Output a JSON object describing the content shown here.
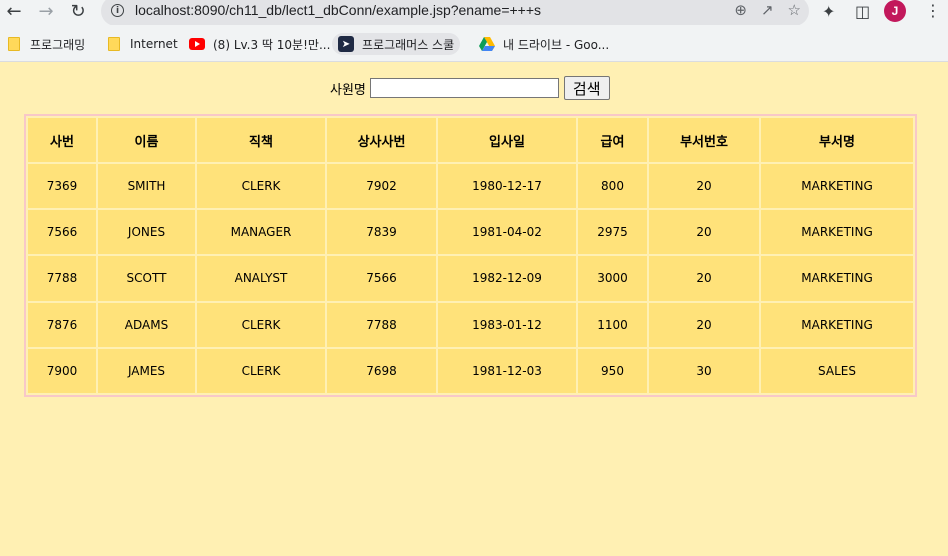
{
  "browser": {
    "url": "localhost:8090/ch11_db/lect1_dbConn/example.jsp?ename=+++s",
    "avatar_letter": "J",
    "bookmarks": [
      {
        "label": "프로그래밍",
        "icon": "folder-icon"
      },
      {
        "label": "Internet",
        "icon": "folder-icon"
      },
      {
        "label": "(8) Lv.3 딱 10분!만...",
        "icon": "youtube-icon"
      },
      {
        "label": "프로그래머스 스쿨",
        "icon": "programmers-icon"
      },
      {
        "label": "내 드라이브 - Goo...",
        "icon": "google-drive-icon"
      }
    ]
  },
  "search": {
    "label": "사원명",
    "value": "",
    "button": "검색"
  },
  "table": {
    "headers": [
      "사번",
      "이름",
      "직책",
      "상사사번",
      "입사일",
      "급여",
      "부서번호",
      "부서명"
    ],
    "rows": [
      [
        "7369",
        "SMITH",
        "CLERK",
        "7902",
        "1980-12-17",
        "800",
        "20",
        "MARKETING"
      ],
      [
        "7566",
        "JONES",
        "MANAGER",
        "7839",
        "1981-04-02",
        "2975",
        "20",
        "MARKETING"
      ],
      [
        "7788",
        "SCOTT",
        "ANALYST",
        "7566",
        "1982-12-09",
        "3000",
        "20",
        "MARKETING"
      ],
      [
        "7876",
        "ADAMS",
        "CLERK",
        "7788",
        "1983-01-12",
        "1100",
        "20",
        "MARKETING"
      ],
      [
        "7900",
        "JAMES",
        "CLERK",
        "7698",
        "1981-12-03",
        "950",
        "30",
        "SALES"
      ]
    ]
  },
  "colors": {
    "page_bg": "#fff0b3",
    "cell_bg": "#ffe27a",
    "table_border": "#f8c8c8"
  }
}
